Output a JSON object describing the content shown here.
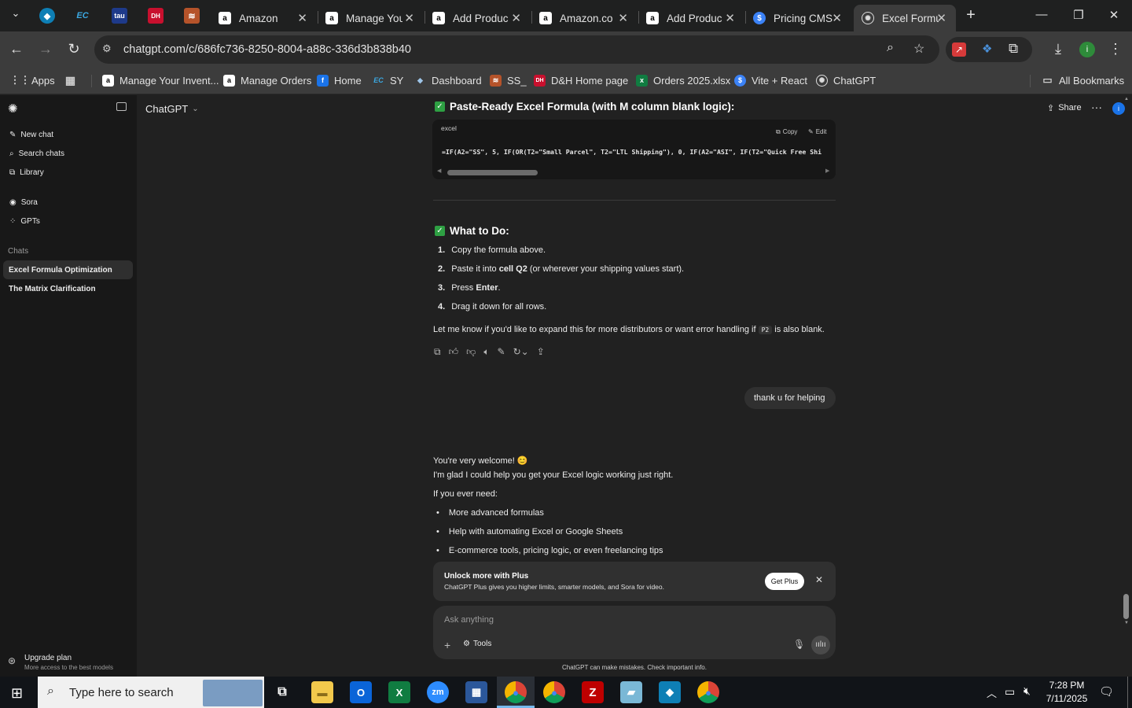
{
  "browser": {
    "tabs": [
      {
        "title": "Amazon",
        "icon": "amazon-icon"
      },
      {
        "title": "Manage You",
        "icon": "amazon-icon"
      },
      {
        "title": "Add Produc",
        "icon": "amazon-icon"
      },
      {
        "title": "Amazon.co",
        "icon": "amazon-icon"
      },
      {
        "title": "Add Produc",
        "icon": "amazon-icon"
      },
      {
        "title": "Pricing CMS",
        "icon": "dollar-icon"
      },
      {
        "title": "Excel Formu",
        "icon": "chatgpt-icon"
      }
    ],
    "pinned": [
      "EC",
      "DH"
    ],
    "url": "chatgpt.com/c/686fc736-8250-8004-a88c-336d3b838b40",
    "bookmarks": [
      {
        "label": "Apps"
      },
      {
        "label": "Manage Your Invent..."
      },
      {
        "label": "Manage Orders"
      },
      {
        "label": "Home"
      },
      {
        "label": "SY"
      },
      {
        "label": "Dashboard"
      },
      {
        "label": "SS_"
      },
      {
        "label": "D&H Home page"
      },
      {
        "label": "Orders 2025.xlsx"
      },
      {
        "label": "Vite + React"
      },
      {
        "label": "ChatGPT"
      }
    ],
    "all_bookmarks": "All Bookmarks",
    "profile_initial": "i"
  },
  "sidebar": {
    "new_chat": "New chat",
    "search_chats": "Search chats",
    "library": "Library",
    "sora": "Sora",
    "gpts": "GPTs",
    "chats_heading": "Chats",
    "chats": [
      "Excel Formula Optimization",
      "The Matrix Clarification"
    ],
    "upgrade_title": "Upgrade plan",
    "upgrade_sub": "More access to the best models"
  },
  "header": {
    "model": "ChatGPT",
    "share": "Share",
    "profile_initial": "i"
  },
  "conversation": {
    "heading1": "Paste-Ready Excel Formula (with M column blank logic):",
    "code_lang": "excel",
    "copy": "Copy",
    "edit": "Edit",
    "code": "=IF(A2=\"SS\", 5, IF(OR(T2=\"Small Parcel\", T2=\"LTL Shipping\"), 0, IF(A2=\"ASI\", IF(T2=\"Quick Free Shi",
    "heading2": "What to Do:",
    "steps": [
      {
        "n": "1.",
        "pre": "Copy the formula above.",
        "bold": "",
        "post": ""
      },
      {
        "n": "2.",
        "pre": "Paste it into ",
        "bold": "cell Q2",
        "post": " (or wherever your shipping values start)."
      },
      {
        "n": "3.",
        "pre": "Press ",
        "bold": "Enter",
        "post": "."
      },
      {
        "n": "4.",
        "pre": "Drag it down for all rows.",
        "bold": "",
        "post": ""
      }
    ],
    "followup_pre": "Let me know if you'd like to expand this for more distributors or want error handling if ",
    "followup_code": "P2",
    "followup_post": " is also blank.",
    "user_message": "thank u for helping",
    "reply_line1": "You're very welcome! 😊",
    "reply_line2": "I'm glad I could help you get your Excel logic working just right.",
    "reply_line3": "If you ever need:",
    "bullets": [
      "More advanced formulas",
      "Help with automating Excel or Google Sheets",
      "E-commerce tools, pricing logic, or even freelancing tips"
    ]
  },
  "upsell": {
    "title": "Unlock more with Plus",
    "subtitle": "ChatGPT Plus gives you higher limits, smarter models, and Sora for video.",
    "button": "Get Plus"
  },
  "composer": {
    "placeholder": "Ask anything",
    "tools": "Tools",
    "disclaimer": "ChatGPT can make mistakes. Check important info."
  },
  "taskbar": {
    "search_placeholder": "Type here to search",
    "time": "7:28 PM",
    "date": "7/11/2025"
  },
  "colors": {
    "accent_green": "#2ea043",
    "chat_bg": "#212121",
    "sidebar_bg": "#181818",
    "tab_active": "#3c3c3c",
    "profile_blue": "#1a73e8"
  }
}
